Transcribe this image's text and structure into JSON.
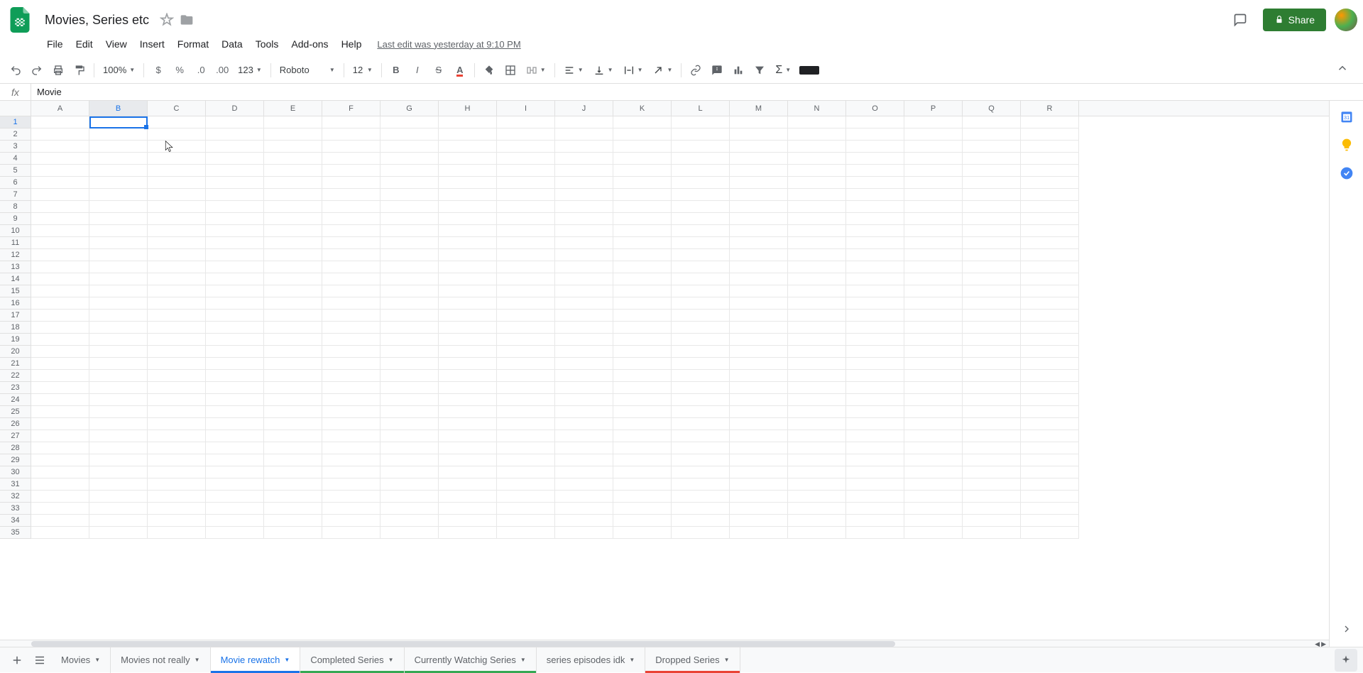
{
  "doc": {
    "title": "Movies, Series etc",
    "last_edit": "Last edit was yesterday at 9:10 PM"
  },
  "menu": [
    "File",
    "Edit",
    "View",
    "Insert",
    "Format",
    "Data",
    "Tools",
    "Add-ons",
    "Help"
  ],
  "share_label": "Share",
  "toolbar": {
    "zoom": "100%",
    "currency": "$",
    "percent": "%",
    "dec_less": ".0",
    "dec_more": ".00",
    "format_menu": "123",
    "font": "Roboto",
    "font_size": "12"
  },
  "formula_bar": {
    "fx": "fx",
    "value": "Movie"
  },
  "columns": [
    "A",
    "B",
    "C",
    "D",
    "E",
    "F",
    "G",
    "H",
    "I",
    "J",
    "K",
    "L",
    "M",
    "N",
    "O",
    "P",
    "Q",
    "R"
  ],
  "rows": [
    1,
    2,
    3,
    4,
    5,
    6,
    7,
    8,
    9,
    10,
    11,
    12,
    13,
    14,
    15,
    16,
    17,
    18,
    19,
    20,
    21,
    22,
    23,
    24,
    25,
    26,
    27,
    28,
    29,
    30,
    31,
    32,
    33,
    34,
    35
  ],
  "selection": {
    "col": "B",
    "row": 1
  },
  "tabs": [
    {
      "label": "Movies",
      "active": false,
      "color": "none"
    },
    {
      "label": "Movies not really",
      "active": false,
      "color": "none"
    },
    {
      "label": "Movie rewatch",
      "active": true,
      "color": "blue"
    },
    {
      "label": "Completed Series",
      "active": false,
      "color": "green"
    },
    {
      "label": "Currently Watchig Series",
      "active": false,
      "color": "green"
    },
    {
      "label": "series episodes idk",
      "active": false,
      "color": "none"
    },
    {
      "label": "Dropped Series",
      "active": false,
      "color": "red"
    }
  ]
}
